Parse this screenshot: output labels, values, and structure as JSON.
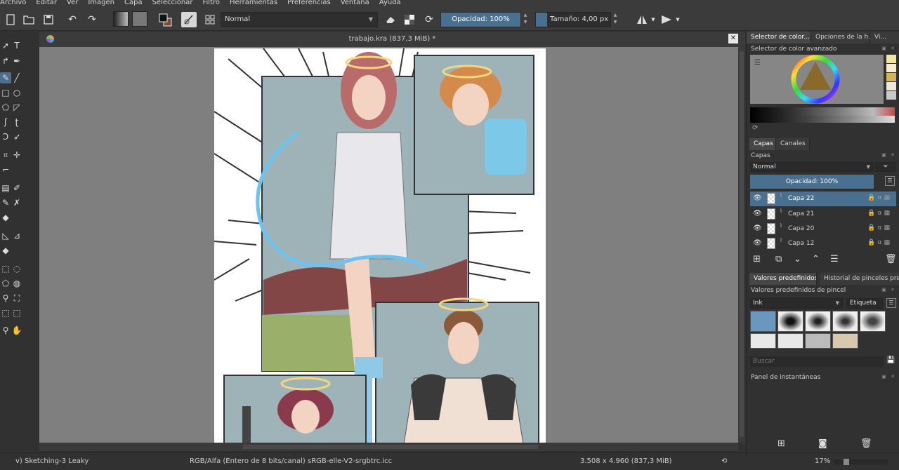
{
  "menu": [
    "Archivo",
    "Editar",
    "Ver",
    "Imagen",
    "Capa",
    "Seleccionar",
    "Filtro",
    "Herramientas",
    "Preferencias",
    "Ventana",
    "Ayuda"
  ],
  "toolbar": {
    "blend_mode": "Normal",
    "opacity_label": "Opacidad: 100%",
    "opacity_value": 1.0,
    "size_label": "Tamaño: 4,00 px"
  },
  "document": {
    "title": "trabajo.kra (837,3 MiB) *"
  },
  "docker": {
    "tabs": [
      "Selector de color...",
      "Opciones de la h...",
      "Vi..."
    ],
    "color_selector_title": "Selector de color avanzado",
    "layer_tabs": [
      "Capas",
      "Canales"
    ],
    "layers_title": "Capas",
    "layer_blend": "Normal",
    "layer_opacity": "Opacidad:  100%",
    "layers": [
      {
        "name": "Capa 22",
        "selected": true
      },
      {
        "name": "Capa 21",
        "selected": false
      },
      {
        "name": "Capa 20",
        "selected": false
      },
      {
        "name": "Capa 12",
        "selected": false
      }
    ],
    "preset_tabs": [
      "Valores predefinidos ...",
      "Historial de pinceles pre..."
    ],
    "presets_title": "Valores predefinidos de pincel",
    "preset_tag": "Ink",
    "tag_button": "Etiqueta",
    "search_placeholder": "Buscar",
    "snapshot_title": "Panel de instantáneas"
  },
  "status": {
    "brush": "v) Sketching-3 Leaky",
    "color_model": "RGB/Alfa (Entero de 8 bits/canal)  sRGB-elle-V2-srgbtrc.icc",
    "dimensions": "3.508 x 4.960 (837,3 MiB)",
    "zoom": "17%"
  },
  "colors": {
    "accent": "#4a6f8f",
    "background": "#313131",
    "canvas_bg": "#7f7f7f"
  }
}
